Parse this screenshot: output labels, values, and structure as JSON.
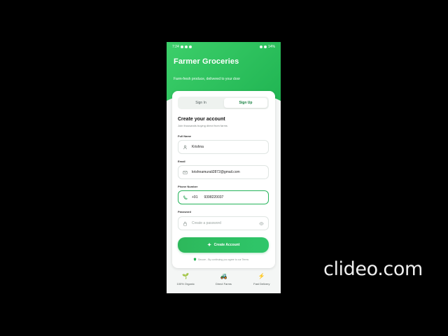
{
  "status_bar": {
    "time": "7:24",
    "battery": "14%"
  },
  "header": {
    "title": "Farmer Groceries",
    "subtitle": "Farm-fresh produce, delivered to your door"
  },
  "auth_tabs": [
    {
      "label": "Sign In",
      "active": false
    },
    {
      "label": "Sign Up",
      "active": true
    }
  ],
  "form": {
    "title": "Create your account",
    "subtitle": "Join thousands buying direct from farms",
    "full_name": {
      "label": "Full Name",
      "value": "Krishna"
    },
    "email": {
      "label": "Email",
      "value": "krishnamurali2872@gmail.com"
    },
    "phone": {
      "label": "Phone Number",
      "country_code": "+91",
      "value": "9398220037"
    },
    "password": {
      "label": "Password",
      "placeholder": "Create a password"
    },
    "submit_label": "Create Account",
    "secure_note": "Secure - By continuing you agree to our Terms"
  },
  "features": [
    {
      "label": "100% Organic",
      "icon": "sprout-icon"
    },
    {
      "label": "Direct Farms",
      "icon": "tractor-icon"
    },
    {
      "label": "Fast Delivery",
      "icon": "lightning-icon"
    }
  ],
  "watermark": "clideo.com",
  "colors": {
    "primary_green": "#20b452",
    "page_background": "#000000",
    "card_background": "#ffffff"
  }
}
